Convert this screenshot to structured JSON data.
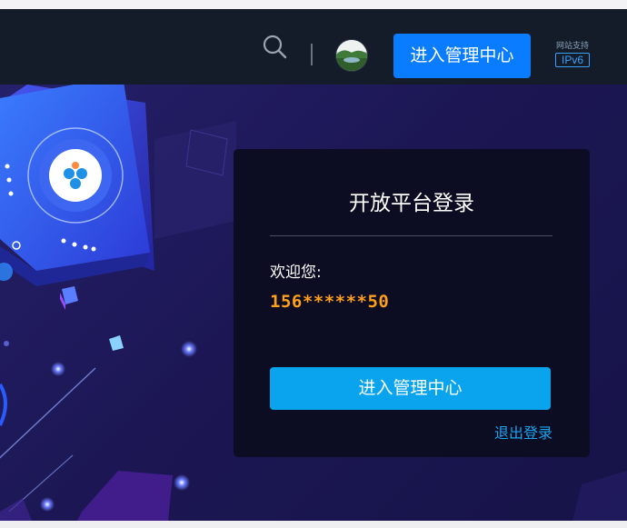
{
  "header": {
    "search_icon": "search-icon",
    "avatar_icon": "avatar-image",
    "admin_button_label": "进入管理中心",
    "ipv6_small": "网站支持",
    "ipv6_badge": "IPv6"
  },
  "login_card": {
    "title": "开放平台登录",
    "welcome": "欢迎您:",
    "phone": "156******50",
    "enter_button_label": "进入管理中心",
    "logout_link": "退出登录"
  },
  "colors": {
    "header_bg": "#141c29",
    "accent_blue": "#0a7cff",
    "button_cyan": "#0aa3ee",
    "phone_orange": "#ff9f1a",
    "card_bg": "#0c0d22"
  }
}
